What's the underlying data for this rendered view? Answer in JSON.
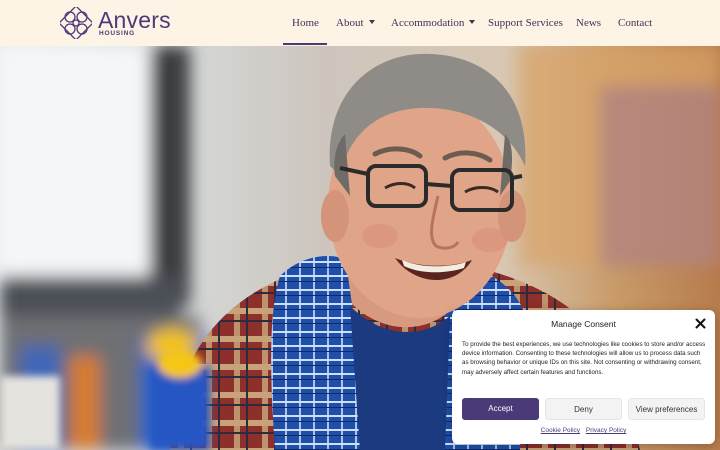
{
  "brand": {
    "name": "Anvers",
    "tagline": "HOUSING",
    "color": "#4b3a78"
  },
  "nav": {
    "items": [
      {
        "label": "Home",
        "active": true,
        "dropdown": false
      },
      {
        "label": "About",
        "active": false,
        "dropdown": true
      },
      {
        "label": "Accommodation",
        "active": false,
        "dropdown": true
      },
      {
        "label": "Support Services",
        "active": false,
        "dropdown": false
      },
      {
        "label": "News",
        "active": false,
        "dropdown": false
      },
      {
        "label": "Contact",
        "active": false,
        "dropdown": false
      }
    ]
  },
  "hero": {
    "image": "smiling-older-man-glasses-plaid-shirt"
  },
  "consent": {
    "title": "Manage Consent",
    "body": "To provide the best experiences, we use technologies like cookies to store and/or access device information. Consenting to these technologies will allow us to process data such as browsing behavior or unique IDs on this site. Not consenting or withdrawing consent, may adversely affect certain features and functions.",
    "accept_label": "Accept",
    "deny_label": "Deny",
    "prefs_label": "View preferences",
    "cookie_policy_label": "Cookie Policy",
    "privacy_policy_label": "Privacy Policy",
    "close_icon": "close-icon"
  }
}
